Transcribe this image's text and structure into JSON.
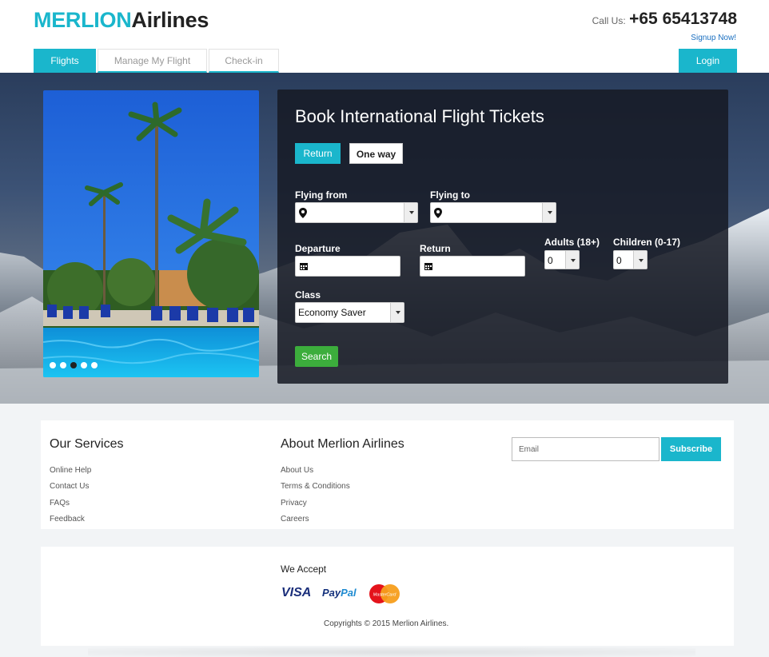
{
  "brand": {
    "part1": "MERLION",
    "part2": "Airlines"
  },
  "contact": {
    "label": "Call Us:",
    "phone": "+65 65413748",
    "signup": "Signup Now!"
  },
  "nav": {
    "tabs": [
      "Flights",
      "Manage My Flight",
      "Check-in"
    ],
    "active_tab": "Flights",
    "login": "Login"
  },
  "slider": {
    "slide_count": 5,
    "active_slide": 3
  },
  "booking": {
    "title": "Book International Flight Tickets",
    "trip_types": [
      "Return",
      "One way"
    ],
    "selected_trip_type": "Return",
    "flying_from_label": "Flying from",
    "flying_from_value": "",
    "flying_to_label": "Flying to",
    "flying_to_value": "",
    "departure_label": "Departure",
    "departure_value": "",
    "return_label": "Return",
    "return_value": "",
    "adults_label": "Adults (18+)",
    "adults_value": "0",
    "children_label": "Children (0-17)",
    "children_value": "0",
    "class_label": "Class",
    "class_value": "Economy Saver",
    "search_label": "Search"
  },
  "services": {
    "title": "Our Services",
    "links": [
      "Online Help",
      "Contact Us",
      "FAQs",
      "Feedback"
    ]
  },
  "about": {
    "title": "About Merlion Airlines",
    "links": [
      "About Us",
      "Terms & Conditions",
      "Privacy",
      "Careers"
    ]
  },
  "newsletter": {
    "placeholder": "Email",
    "button": "Subscribe"
  },
  "payments": {
    "title": "We Accept",
    "visa": "VISA",
    "paypal_a": "Pay",
    "paypal_b": "Pal",
    "mastercard": "MasterCard"
  },
  "copyright": "Copyrights © 2015 Merlion Airlines.",
  "colors": {
    "accent": "#1ab6cc",
    "search": "#3cad3c",
    "panel": "#161a24"
  }
}
